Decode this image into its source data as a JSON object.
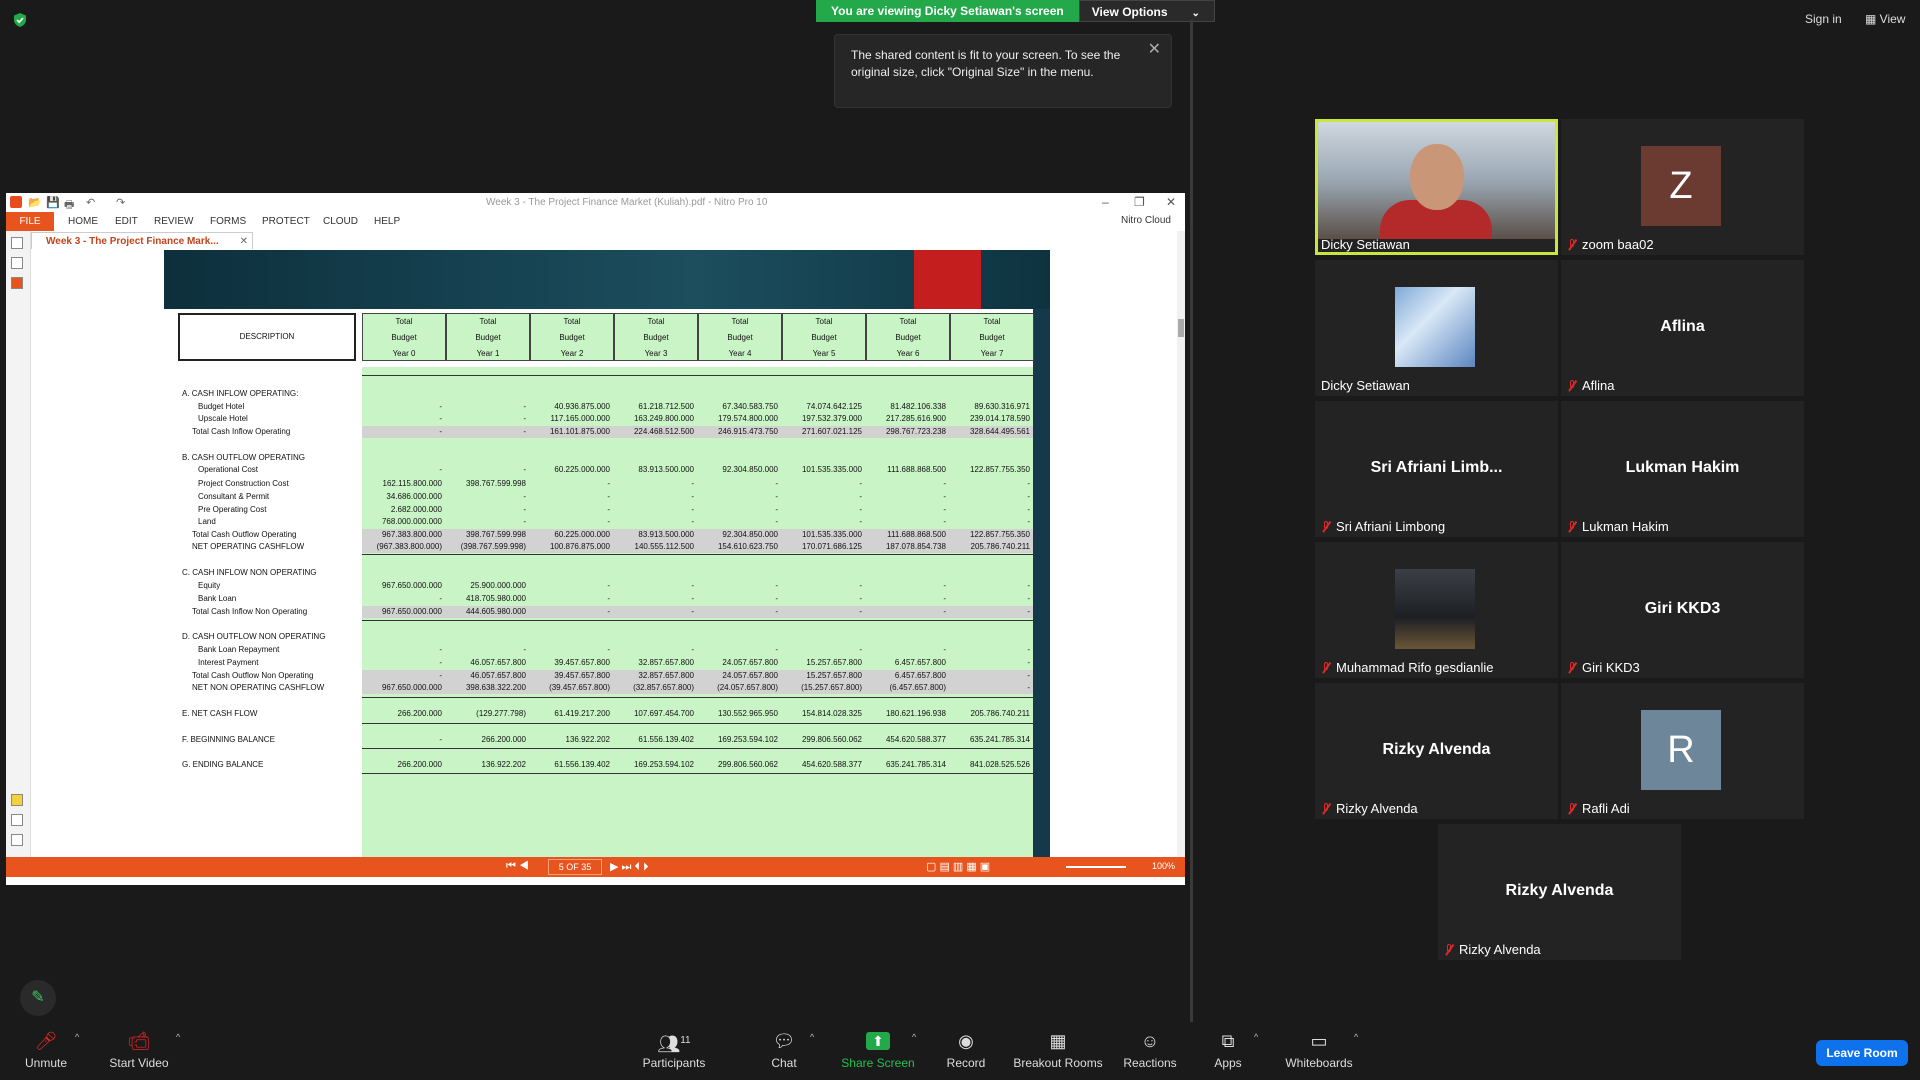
{
  "top": {
    "viewing_banner": "You are viewing Dicky Setiawan's screen",
    "view_options": "View Options",
    "sign_in": "Sign in",
    "view": "View",
    "tooltip": "The shared content is fit to your screen. To see the original size, click \"Original Size\" in the menu."
  },
  "nitro": {
    "title": "Week 3 - The Project Finance Market (Kuliah).pdf - Nitro Pro 10",
    "menu": [
      "FILE",
      "HOME",
      "EDIT",
      "REVIEW",
      "FORMS",
      "PROTECT",
      "CLOUD",
      "HELP"
    ],
    "cloud_label": "Nitro Cloud",
    "doc_tab": "Week 3 - The Project Finance Mark...",
    "page_indicator": "5 OF 35",
    "zoom": "100%"
  },
  "sheet": {
    "desc_header": "DESCRIPTION",
    "columns": [
      "Total\nBudget\nYear 0",
      "Total\nBudget\nYear 1",
      "Total\nBudget\nYear 2",
      "Total\nBudget\nYear 3",
      "Total\nBudget\nYear 4",
      "Total\nBudget\nYear 5",
      "Total\nBudget\nYear 6",
      "Total\nBudget\nYear 7"
    ],
    "rows": [
      {
        "label": "A.   CASH INFLOW OPERATING:",
        "values": [
          "",
          "",
          "",
          "",
          "",
          "",
          "",
          ""
        ]
      },
      {
        "label": "Budget Hotel",
        "values": [
          "-",
          "-",
          "40.936.875.000",
          "61.218.712.500",
          "67.340.583.750",
          "74.074.642.125",
          "81.482.106.338",
          "89.630.316.971"
        ]
      },
      {
        "label": "Upscale Hotel",
        "values": [
          "-",
          "-",
          "117.165.000.000",
          "163.249.800.000",
          "179.574.800.000",
          "197.532.379.000",
          "217.285.616.900",
          "239.014.178.590"
        ]
      },
      {
        "label": "Total Cash Inflow Operating",
        "values": [
          "-",
          "-",
          "161.101.875.000",
          "224.468.512.500",
          "246.915.473.750",
          "271.607.021.125",
          "298.767.723.238",
          "328.644.495.561"
        ]
      },
      {
        "label": "B.   CASH OUTFLOW OPERATING",
        "values": [
          "",
          "",
          "",
          "",
          "",
          "",
          "",
          ""
        ]
      },
      {
        "label": "Operational Cost",
        "values": [
          "-",
          "-",
          "60.225.000.000",
          "83.913.500.000",
          "92.304.850.000",
          "101.535.335.000",
          "111.688.868.500",
          "122.857.755.350"
        ]
      },
      {
        "label": "Project Construction Cost",
        "values": [
          "162.115.800.000",
          "398.767.599.998",
          "-",
          "-",
          "-",
          "-",
          "-",
          "-"
        ]
      },
      {
        "label": "Consultant & Permit",
        "values": [
          "34.686.000.000",
          "-",
          "-",
          "-",
          "-",
          "-",
          "-",
          "-"
        ]
      },
      {
        "label": "Pre Operating Cost",
        "values": [
          "2.682.000.000",
          "-",
          "-",
          "-",
          "-",
          "-",
          "-",
          "-"
        ]
      },
      {
        "label": "Land",
        "values": [
          "768.000.000.000",
          "-",
          "-",
          "-",
          "-",
          "-",
          "-",
          "-"
        ]
      },
      {
        "label": "Total Cash Outflow Operating",
        "values": [
          "967.383.800.000",
          "398.767.599.998",
          "60.225.000.000",
          "83.913.500.000",
          "92.304.850.000",
          "101.535.335.000",
          "111.688.868.500",
          "122.857.755.350"
        ]
      },
      {
        "label": "NET OPERATING CASHFLOW",
        "values": [
          "(967.383.800.000)",
          "(398.767.599.998)",
          "100.876.875.000",
          "140.555.112.500",
          "154.610.623.750",
          "170.071.686.125",
          "187.078.854.738",
          "205.786.740.211"
        ]
      },
      {
        "label": "C.   CASH INFLOW NON OPERATING",
        "values": [
          "",
          "",
          "",
          "",
          "",
          "",
          "",
          ""
        ]
      },
      {
        "label": "Equity",
        "values": [
          "967.650.000.000",
          "25.900.000.000",
          "-",
          "-",
          "-",
          "-",
          "-",
          "-"
        ]
      },
      {
        "label": "Bank Loan",
        "values": [
          "-",
          "418.705.980.000",
          "-",
          "-",
          "-",
          "-",
          "-",
          "-"
        ]
      },
      {
        "label": "Total Cash Inflow Non Operating",
        "values": [
          "967.650.000.000",
          "444.605.980.000",
          "-",
          "-",
          "-",
          "-",
          "-",
          "-"
        ]
      },
      {
        "label": "D.   CASH OUTFLOW NON OPERATING",
        "values": [
          "",
          "",
          "",
          "",
          "",
          "",
          "",
          ""
        ]
      },
      {
        "label": "Bank Loan Repayment",
        "values": [
          "-",
          "-",
          "-",
          "-",
          "-",
          "-",
          "-",
          "-"
        ]
      },
      {
        "label": "Interest Payment",
        "values": [
          "-",
          "46.057.657.800",
          "39.457.657.800",
          "32.857.657.800",
          "24.057.657.800",
          "15.257.657.800",
          "6.457.657.800",
          "-"
        ]
      },
      {
        "label": "Total Cash Outflow Non Operating",
        "values": [
          "-",
          "46.057.657.800",
          "39.457.657.800",
          "32.857.657.800",
          "24.057.657.800",
          "15.257.657.800",
          "6.457.657.800",
          "-"
        ]
      },
      {
        "label": "NET NON OPERATING CASHFLOW",
        "values": [
          "967.650.000.000",
          "398.638.322.200",
          "(39.457.657.800)",
          "(32.857.657.800)",
          "(24.057.657.800)",
          "(15.257.657.800)",
          "(6.457.657.800)",
          "-"
        ]
      },
      {
        "label": "E.   NET CASH FLOW",
        "values": [
          "266.200.000",
          "(129.277.798)",
          "61.419.217.200",
          "107.697.454.700",
          "130.552.965.950",
          "154.814.028.325",
          "180.621.196.938",
          "205.786.740.211"
        ]
      },
      {
        "label": "F.   BEGINNING BALANCE",
        "values": [
          "-",
          "266.200.000",
          "136.922.202",
          "61.556.139.402",
          "169.253.594.102",
          "299.806.560.062",
          "454.620.588.377",
          "635.241.785.314"
        ]
      },
      {
        "label": "G.   ENDING BALANCE",
        "values": [
          "266.200.000",
          "136.922.202",
          "61.556.139.402",
          "169.253.594.102",
          "299.806.560.062",
          "454.620.588.377",
          "635.241.785.314",
          "841.028.525.526"
        ]
      }
    ]
  },
  "participants": [
    {
      "name": "Dicky Setiawan",
      "type": "video",
      "muted": false
    },
    {
      "name": "zoom baa02",
      "type": "avatar",
      "letter": "Z",
      "color": "#6b3b32",
      "muted": true
    },
    {
      "name": "Dicky Setiawan",
      "type": "building",
      "muted": false
    },
    {
      "name": "Aflina",
      "type": "text",
      "display": "Aflina",
      "muted": true
    },
    {
      "name": "Sri Afriani Limbong",
      "type": "text",
      "display": "Sri Afriani  Limb...",
      "muted": true
    },
    {
      "name": "Lukman Hakim",
      "type": "text",
      "display": "Lukman Hakim",
      "muted": true
    },
    {
      "name": "Muhammad Rifo gesdianlie",
      "type": "night",
      "muted": true
    },
    {
      "name": "Giri KKD3",
      "type": "text",
      "display": "Giri KKD3",
      "muted": true
    },
    {
      "name": "Rizky Alvenda",
      "type": "text",
      "display": "Rizky Alvenda",
      "muted": true
    },
    {
      "name": "Rafli Adi",
      "type": "avatar",
      "letter": "R",
      "color": "#6d8699",
      "muted": true
    },
    {
      "name": "Rizky Alvenda",
      "type": "text",
      "display": "Rizky Alvenda",
      "muted": true
    }
  ],
  "toolbar": {
    "unmute": "Unmute",
    "start_video": "Start Video",
    "participants": "Participants",
    "participants_count": "11",
    "chat": "Chat",
    "share_screen": "Share Screen",
    "record": "Record",
    "breakout_rooms": "Breakout Rooms",
    "reactions": "Reactions",
    "apps": "Apps",
    "whiteboards": "Whiteboards",
    "leave_room": "Leave Room"
  }
}
